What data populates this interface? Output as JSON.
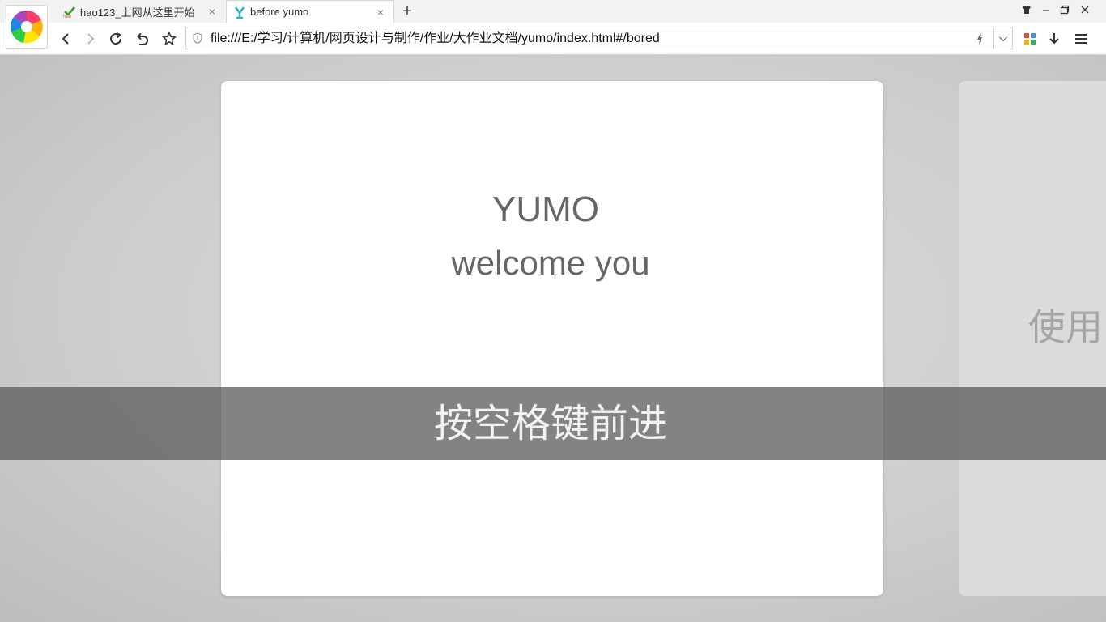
{
  "tabs": [
    {
      "title": "hao123_上网从这里开始",
      "icon": "hao123-icon",
      "close": "×"
    },
    {
      "title": "before yumo",
      "icon": "yumo-icon",
      "close": "×"
    }
  ],
  "new_tab_label": "+",
  "address_bar": {
    "url": "file:///E:/学习/计算机/网页设计与制作/作业/大作业文档/yumo/index.html#/bored"
  },
  "slide": {
    "title": "YUMO",
    "subtitle": "welcome you"
  },
  "next_slide": {
    "text": "使用"
  },
  "overlay": {
    "text": "按空格键前进"
  },
  "colors": {
    "tabstrip": "#f2f2f2",
    "overlay": "#5a5a5a",
    "slide_text": "#666666"
  }
}
